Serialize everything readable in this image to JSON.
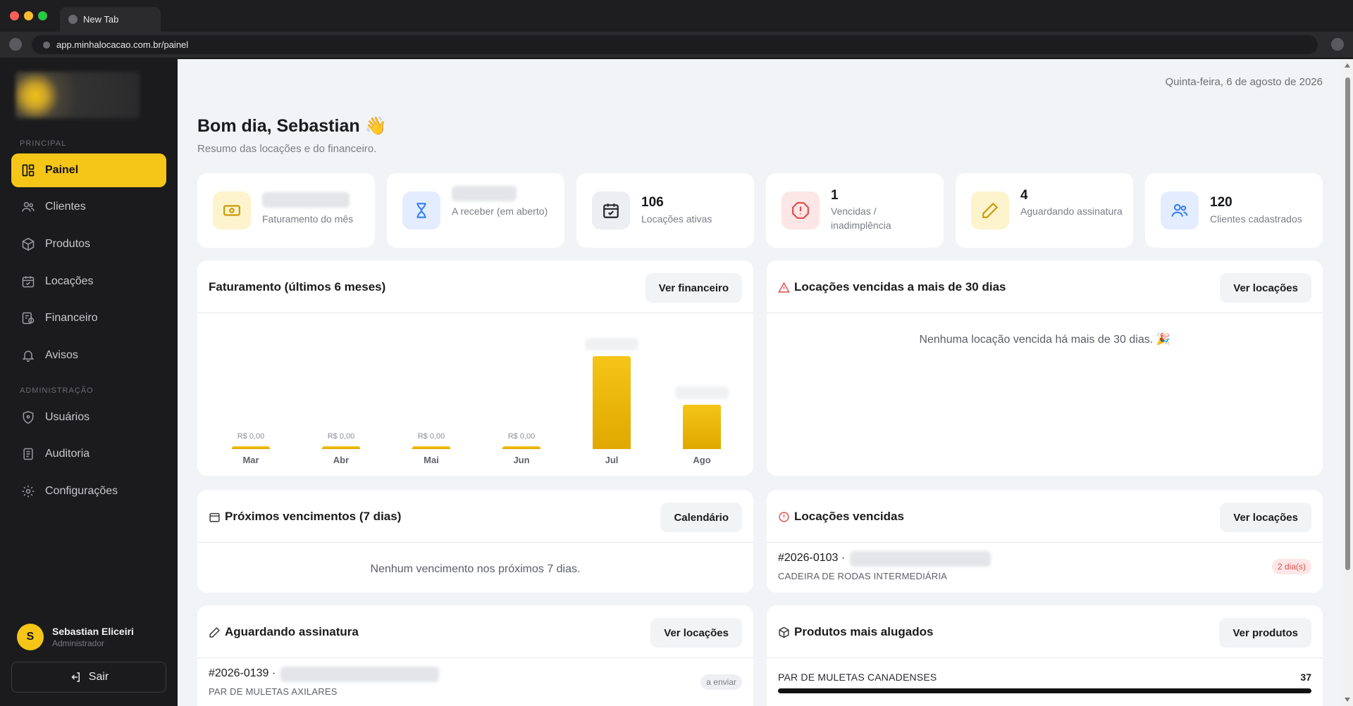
{
  "browser": {
    "tab_title": "New Tab",
    "url": "app.minhalocacao.com.br/painel"
  },
  "sidebar": {
    "section_principal": "PRINCIPAL",
    "section_admin": "ADMINISTRAÇÃO",
    "items": [
      {
        "label": "Painel",
        "icon": "layout-icon",
        "active": true
      },
      {
        "label": "Clientes",
        "icon": "users-icon"
      },
      {
        "label": "Produtos",
        "icon": "box-icon"
      },
      {
        "label": "Locações",
        "icon": "calendar-check-icon"
      },
      {
        "label": "Financeiro",
        "icon": "finance-icon"
      },
      {
        "label": "Avisos",
        "icon": "bell-icon"
      }
    ],
    "admin_items": [
      {
        "label": "Usuários",
        "icon": "shield-icon"
      },
      {
        "label": "Auditoria",
        "icon": "document-icon"
      },
      {
        "label": "Configurações",
        "icon": "gear-icon"
      }
    ],
    "user": {
      "initial": "S",
      "name": "Sebastian Eliceiri",
      "role": "Administrador"
    },
    "logout_label": "Sair"
  },
  "header": {
    "date": "Quinta-feira, 6 de agosto de 2026",
    "greeting": "Bom dia, Sebastian 👋",
    "subtitle": "Resumo das locações e do financeiro."
  },
  "stats": [
    {
      "label": "Faturamento do mês",
      "icon": "money-icon",
      "color": "#f5c518"
    },
    {
      "label": "A receber (em aberto)",
      "icon": "hourglass-icon",
      "color": "#3b82f6"
    },
    {
      "value": "106",
      "label": "Locações ativas",
      "icon": "calendar-check-icon"
    },
    {
      "value": "1",
      "label": "Vencidas / inadimplência",
      "icon": "alert-octagon-icon",
      "color": "#ef4444"
    },
    {
      "value": "4",
      "label": "Aguardando assinatura",
      "icon": "pen-icon",
      "color": "#d4a017"
    },
    {
      "value": "120",
      "label": "Clientes cadastrados",
      "icon": "users-icon",
      "color": "#3b82f6"
    }
  ],
  "revenue_panel": {
    "title": "Faturamento (últimos 6 meses)",
    "button": "Ver financeiro"
  },
  "chart_data": {
    "type": "bar",
    "categories": [
      "Mar",
      "Abr",
      "Mai",
      "Jun",
      "Jul",
      "Ago"
    ],
    "values": [
      0,
      0,
      0,
      0,
      100,
      48
    ],
    "data_labels": [
      "R$ 0,00",
      "R$ 0,00",
      "R$ 0,00",
      "R$ 0,00",
      "",
      ""
    ],
    "title": "Faturamento (últimos 6 meses)",
    "bar_color": "#f5c518"
  },
  "overdue30_panel": {
    "title": "Locações vencidas a mais de 30 dias",
    "button": "Ver locações",
    "empty": "Nenhuma locação vencida há mais de 30 dias. 🎉"
  },
  "upcoming_panel": {
    "title": "Próximos vencimentos (7 dias)",
    "button": "Calendário",
    "empty": "Nenhum vencimento nos próximos 7 dias."
  },
  "overdue_panel": {
    "title": "Locações vencidas",
    "button": "Ver locações",
    "rows": [
      {
        "code": "#2026-0103 ·",
        "product": "CADEIRA DE RODAS INTERMEDIÁRIA",
        "badge": "2 dia(s)"
      }
    ]
  },
  "signature_panel": {
    "title": "Aguardando assinatura",
    "button": "Ver locações",
    "rows": [
      {
        "code": "#2026-0139 ·",
        "product": "PAR DE MULETAS AXILARES",
        "badge": "a enviar"
      }
    ]
  },
  "top_products_panel": {
    "title": "Produtos mais alugados",
    "button": "Ver produtos",
    "rows": [
      {
        "product": "PAR DE MULETAS CANADENSES",
        "count": "37",
        "share": 1.0
      }
    ]
  }
}
